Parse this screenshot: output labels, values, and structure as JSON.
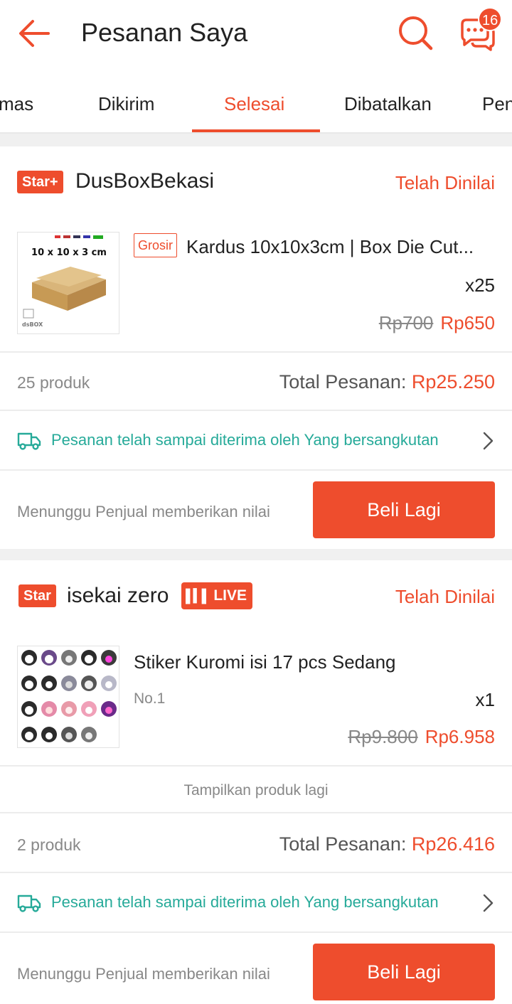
{
  "header": {
    "title": "Pesanan Saya",
    "chat_badge": "16"
  },
  "tabs": [
    {
      "label": "mas"
    },
    {
      "label": "Dikirim"
    },
    {
      "label": "Selesai"
    },
    {
      "label": "Dibatalkan"
    },
    {
      "label": "Pen"
    }
  ],
  "orders": [
    {
      "shop_badge": "Star+",
      "shop_name": "DusBoxBekasi",
      "status": "Telah Dinilai",
      "product": {
        "tag": "Grosir",
        "name": "Kardus 10x10x3cm | Box Die Cut...",
        "image_label": "10 x 10 x 3 cm",
        "qty": "x25",
        "old_price": "Rp700",
        "price": "Rp650"
      },
      "count": "25 produk",
      "total_label": "Total Pesanan:",
      "total_amount": "Rp25.250",
      "shipping": "Pesanan telah sampai diterima oleh Yang bersangkutan",
      "waiting": "Menunggu Penjual memberikan nilai",
      "button": "Beli Lagi"
    },
    {
      "shop_badge": "Star",
      "shop_name": "isekai zero",
      "live": "LIVE",
      "status": "Telah Dinilai",
      "product": {
        "name": "Stiker Kuromi  isi 17 pcs Sedang",
        "variant": "No.1",
        "qty": "x1",
        "old_price": "Rp9.800",
        "price": "Rp6.958"
      },
      "more": "Tampilkan produk lagi",
      "count": "2 produk",
      "total_label": "Total Pesanan:",
      "total_amount": "Rp26.416",
      "shipping": "Pesanan telah sampai diterima oleh Yang bersangkutan",
      "waiting": "Menunggu Penjual memberikan nilai",
      "button": "Beli Lagi"
    }
  ],
  "colors": {
    "brand": "#ee4d2d",
    "shipping": "#26aa99"
  }
}
